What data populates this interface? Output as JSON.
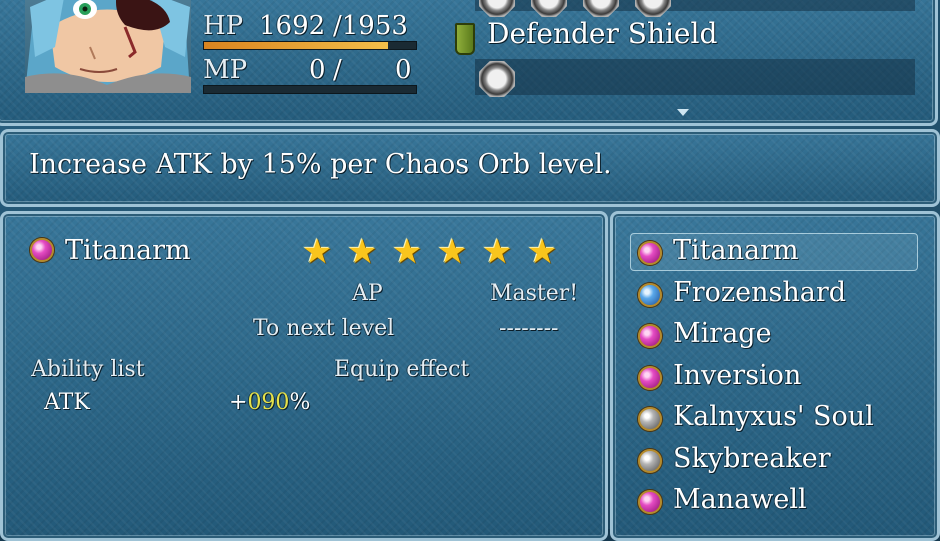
{
  "status": {
    "hp_label": "HP",
    "hp_current": "1692",
    "hp_max": "/1953",
    "hp_fraction": 0.866,
    "mp_label": "MP",
    "mp_current": "0",
    "mp_sep": "/",
    "mp_max": "0",
    "mp_fraction": 0
  },
  "equipment": {
    "shield_label": "Defender Shield"
  },
  "help_text": "Increase ATK by 15% per Chaos Orb level.",
  "detail": {
    "orb_name": "Titanarm",
    "orb_color": "magenta",
    "stars": 6,
    "ap_label": "AP",
    "ap_value": "Master!",
    "next_level_label": "To next level",
    "next_level_value": "--------",
    "ability_list_label": "Ability list",
    "equip_effect_label": "Equip effect",
    "effect_stat": "ATK",
    "effect_sign": "+",
    "effect_value": "090",
    "effect_unit": "%"
  },
  "orb_list": [
    {
      "name": "Titanarm",
      "color": "magenta",
      "selected": true
    },
    {
      "name": "Frozenshard",
      "color": "blue",
      "selected": false
    },
    {
      "name": "Mirage",
      "color": "magenta",
      "selected": false
    },
    {
      "name": "Inversion",
      "color": "magenta",
      "selected": false
    },
    {
      "name": "Kalnyxus' Soul",
      "color": "grey",
      "selected": false
    },
    {
      "name": "Skybreaker",
      "color": "grey",
      "selected": false
    },
    {
      "name": "Manawell",
      "color": "magenta",
      "selected": false
    }
  ],
  "colors": {
    "hp_bar": "#f3bf4a",
    "effect_value": "#e6e24a",
    "system_text": "#e6eef3"
  }
}
